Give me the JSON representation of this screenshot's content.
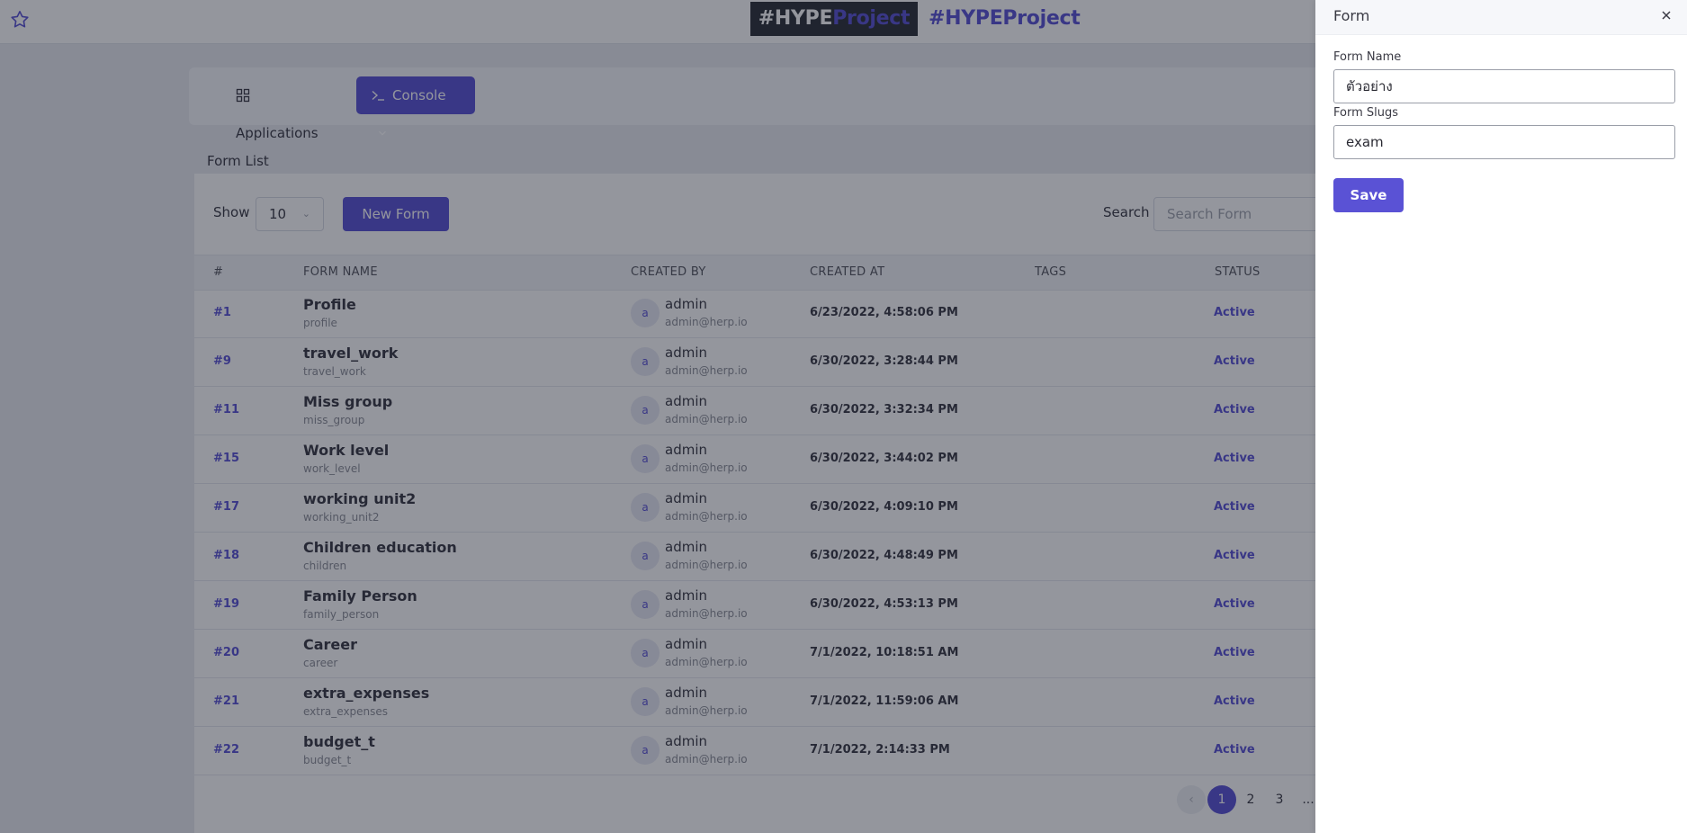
{
  "header": {
    "logo_dark": {
      "prefix": "#HYPE",
      "accent": "Project"
    },
    "logo_light": "#HYPEProject"
  },
  "tabs": [
    {
      "label": "Applications",
      "icon": "grid-icon"
    },
    {
      "label": "Console",
      "icon": "terminal-icon",
      "active": true
    }
  ],
  "page": {
    "section_title": "Form List"
  },
  "list": {
    "show_label": "Show",
    "page_size": "10",
    "new_form_label": "New Form",
    "search_label": "Search",
    "search_placeholder": "Search Form",
    "columns": [
      "#",
      "FORM NAME",
      "CREATED BY",
      "CREATED AT",
      "TAGS",
      "STATUS"
    ],
    "rows": [
      {
        "id": "#1",
        "name": "Profile",
        "slug": "profile",
        "avatar": "a",
        "user": "admin",
        "email": "admin@herp.io",
        "created": "6/23/2022, 4:58:06 PM",
        "status": "Active"
      },
      {
        "id": "#9",
        "name": "travel_work",
        "slug": "travel_work",
        "avatar": "a",
        "user": "admin",
        "email": "admin@herp.io",
        "created": "6/30/2022, 3:28:44 PM",
        "status": "Active"
      },
      {
        "id": "#11",
        "name": "Miss group",
        "slug": "miss_group",
        "avatar": "a",
        "user": "admin",
        "email": "admin@herp.io",
        "created": "6/30/2022, 3:32:34 PM",
        "status": "Active"
      },
      {
        "id": "#15",
        "name": "Work level",
        "slug": "work_level",
        "avatar": "a",
        "user": "admin",
        "email": "admin@herp.io",
        "created": "6/30/2022, 3:44:02 PM",
        "status": "Active"
      },
      {
        "id": "#17",
        "name": "working unit2",
        "slug": "working_unit2",
        "avatar": "a",
        "user": "admin",
        "email": "admin@herp.io",
        "created": "6/30/2022, 4:09:10 PM",
        "status": "Active"
      },
      {
        "id": "#18",
        "name": "Children education",
        "slug": "children",
        "avatar": "a",
        "user": "admin",
        "email": "admin@herp.io",
        "created": "6/30/2022, 4:48:49 PM",
        "status": "Active"
      },
      {
        "id": "#19",
        "name": "Family Person",
        "slug": "family_person",
        "avatar": "a",
        "user": "admin",
        "email": "admin@herp.io",
        "created": "6/30/2022, 4:53:13 PM",
        "status": "Active"
      },
      {
        "id": "#20",
        "name": "Career",
        "slug": "career",
        "avatar": "a",
        "user": "admin",
        "email": "admin@herp.io",
        "created": "7/1/2022, 10:18:51 AM",
        "status": "Active"
      },
      {
        "id": "#21",
        "name": "extra_expenses",
        "slug": "extra_expenses",
        "avatar": "a",
        "user": "admin",
        "email": "admin@herp.io",
        "created": "7/1/2022, 11:59:06 AM",
        "status": "Active"
      },
      {
        "id": "#22",
        "name": "budget_t",
        "slug": "budget_t",
        "avatar": "a",
        "user": "admin",
        "email": "admin@herp.io",
        "created": "7/1/2022, 2:14:33 PM",
        "status": "Active"
      }
    ],
    "pagination": {
      "pages": [
        "1",
        "2",
        "3"
      ],
      "ellipsis": "...",
      "current": "1"
    }
  },
  "drawer": {
    "title": "Form",
    "form_name_label": "Form Name",
    "form_name_value": "ตัวอย่าง",
    "form_slugs_label": "Form Slugs",
    "form_slugs_value": "exam",
    "save_label": "Save"
  },
  "colors": {
    "accent": "#5a52d5",
    "logo_dark_bg": "#2c3137",
    "overlay": "rgba(18,22,38,0.45)"
  }
}
